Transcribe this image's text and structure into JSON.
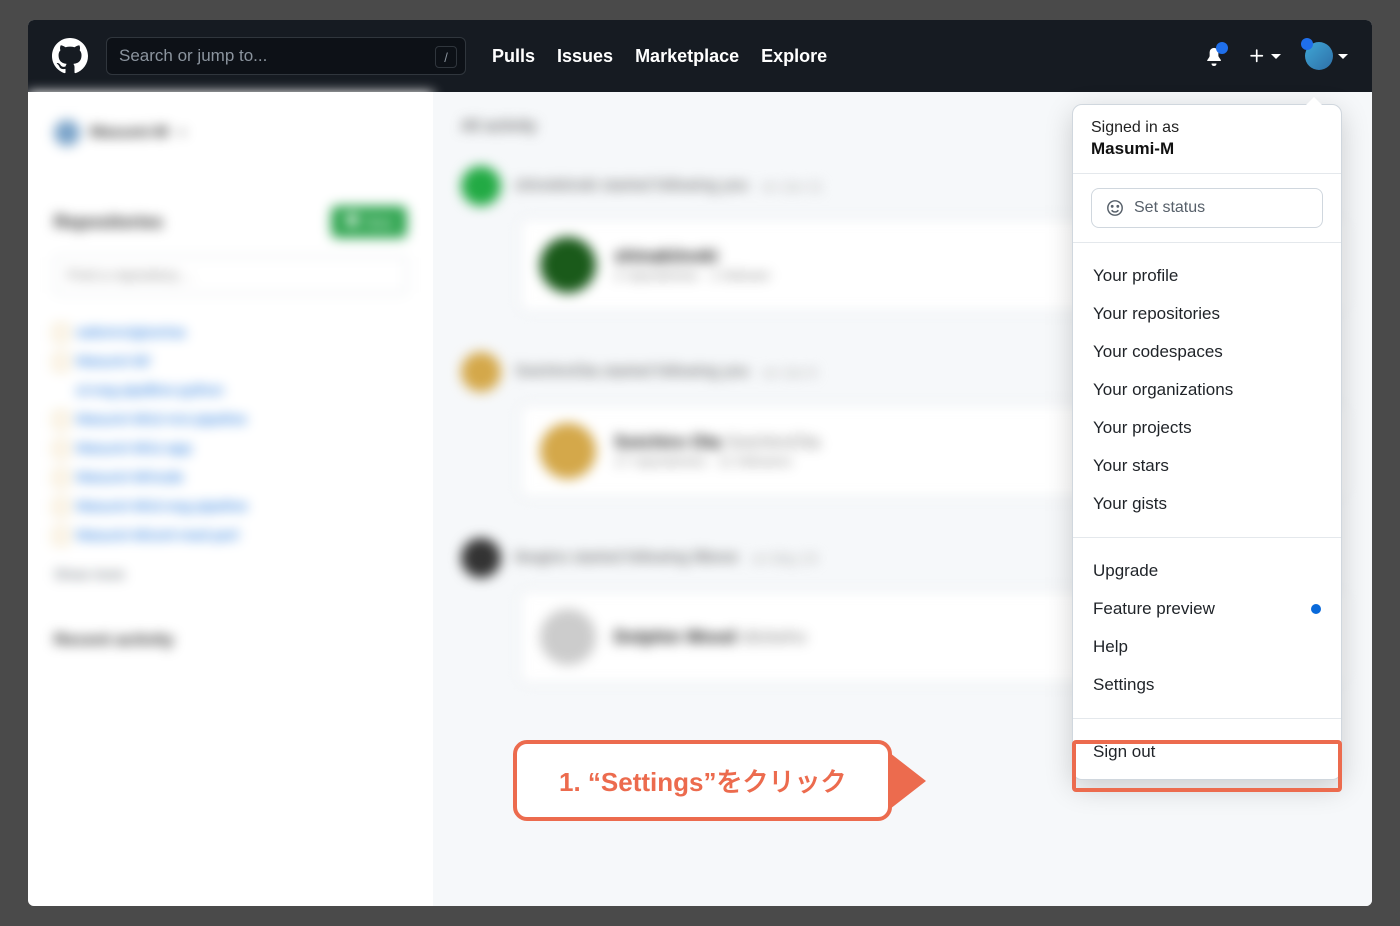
{
  "header": {
    "search_placeholder": "Search or jump to...",
    "slash_hint": "/",
    "nav": {
      "pulls": "Pulls",
      "issues": "Issues",
      "marketplace": "Marketplace",
      "explore": "Explore"
    }
  },
  "sidebar": {
    "username": "Masumi-M",
    "repos_title": "Repositories",
    "new_button": "New",
    "find_placeholder": "Find a repository…",
    "repos": [
      "saitonro/gisorisa",
      "Masumi-M/",
      "ul-esg-pipdline-python",
      "Masumi-M/ul-mvi-pipeline",
      "Masumi-M/ui-app",
      "Masumi-M/node",
      "Masumi-M/ul-esg-pipeline",
      "Masumi-M/uml-med-perl"
    ],
    "show_more": "Show more",
    "recent_title": "Recent activity"
  },
  "feed": {
    "title": "All activity",
    "events": [
      {
        "text": "shinokiinoki started following you",
        "time": "on Jun 11",
        "card_name": "shinakiinoki",
        "card_meta": "2 repositories · 1 follower"
      },
      {
        "text": "SoichiroOta started following you",
        "time": "on Jun 6",
        "card_name": "Soichiro Ota",
        "card_handle": "SoichiroOta",
        "card_meta": "17 repositories · 11 followers"
      },
      {
        "text": "ikwgino started following lilbese",
        "time": "on May 24",
        "card_name": "Dolphin Wood",
        "card_handle": "idiotwho"
      }
    ]
  },
  "dropdown": {
    "signed_in_as": "Signed in as",
    "username": "Masumi-M",
    "set_status": "Set status",
    "items_a": [
      "Your profile",
      "Your repositories",
      "Your codespaces",
      "Your organizations",
      "Your projects",
      "Your stars",
      "Your gists"
    ],
    "items_b": [
      "Upgrade",
      "Feature preview",
      "Help",
      "Settings"
    ],
    "signout": "Sign out"
  },
  "annotation": {
    "text": "1. “Settings”をクリック"
  },
  "colors": {
    "accent": "#ec6b4e",
    "link": "#0969da",
    "primary_green": "#2da44e",
    "header_bg": "#161b22"
  }
}
